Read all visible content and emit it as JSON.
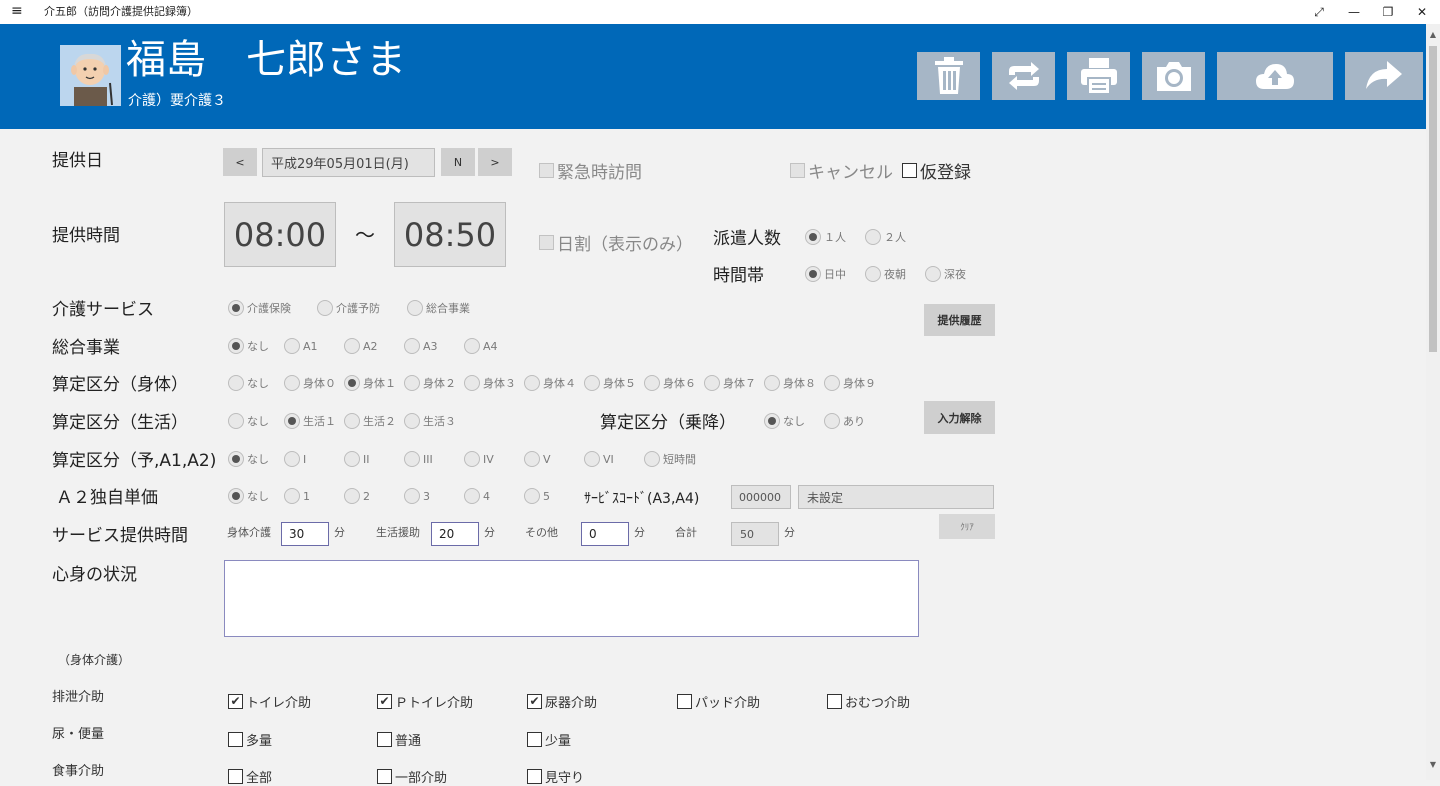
{
  "window": {
    "title": "介五郎（訪問介護提供記録簿）",
    "menu_icon": "hamburger-icon",
    "expand": "⤢",
    "minimize": "—",
    "restore": "❐",
    "close": "✕"
  },
  "header": {
    "name": "福島　七郎さま",
    "care_level": "介護）要介護３",
    "bg_color": "#0068b8"
  },
  "toolbar": {
    "delete": "trash-icon",
    "refresh": "refresh-icon",
    "print": "printer-icon",
    "camera": "camera-icon",
    "upload": "cloud-upload-icon",
    "forward": "share-arrow-icon"
  },
  "date": {
    "label": "提供日",
    "prev": "<",
    "value": "平成29年05月01日(月)",
    "now": "N",
    "next": ">"
  },
  "flags": {
    "emergency": "緊急時訪問",
    "cancel": "キャンセル",
    "provisional": "仮登録",
    "daily": "日割（表示のみ）"
  },
  "time": {
    "label": "提供時間",
    "start": "08:00",
    "sep": "～",
    "end": "08:50"
  },
  "dispatch": {
    "label": "派遣人数",
    "opts": [
      "１人",
      "２人"
    ]
  },
  "timezone": {
    "label": "時間帯",
    "opts": [
      "日中",
      "夜朝",
      "深夜"
    ]
  },
  "service": {
    "label": "介護サービス",
    "opts": [
      "介護保険",
      "介護予防",
      "総合事業"
    ],
    "history_button": "提供履歴"
  },
  "sogo": {
    "label": "総合事業",
    "opts": [
      "なし",
      "A1",
      "A2",
      "A3",
      "A4"
    ]
  },
  "shintai": {
    "label": "算定区分（身体）",
    "opts": [
      "なし",
      "身体０",
      "身体１",
      "身体２",
      "身体３",
      "身体４",
      "身体５",
      "身体６",
      "身体７",
      "身体８",
      "身体９"
    ]
  },
  "seikatsu": {
    "label": "算定区分（生活）",
    "opts": [
      "なし",
      "生活１",
      "生活２",
      "生活３"
    ],
    "clear_button": "入力解除"
  },
  "joukou": {
    "label": "算定区分（乗降）",
    "opts": [
      "なし",
      "あり"
    ]
  },
  "yobou": {
    "label": "算定区分（予,A1,A2)",
    "opts": [
      "なし",
      "I",
      "II",
      "III",
      "IV",
      "V",
      "VI",
      "短時間"
    ]
  },
  "a2": {
    "label": "Ａ２独自単価",
    "opts": [
      "なし",
      "1",
      "2",
      "3",
      "4",
      "5"
    ]
  },
  "service_code": {
    "label": "ｻｰﾋﾞｽｺｰﾄﾞ(A3,A4)",
    "code": "000000",
    "name": "未設定",
    "clear": "ｸﾘｱ"
  },
  "service_time": {
    "label": "サービス提供時間",
    "body_label": "身体介護",
    "body": "30",
    "life_label": "生活援助",
    "life": "20",
    "other_label": "その他",
    "other": "0",
    "total_label": "合計",
    "total": "50",
    "unit": "分"
  },
  "condition": {
    "label": "心身の状況",
    "value": ""
  },
  "body_section": "（身体介護）",
  "excretion": {
    "label": "排泄介助",
    "items": [
      {
        "text": "トイレ介助",
        "checked": true
      },
      {
        "text": "Ｐトイレ介助",
        "checked": true
      },
      {
        "text": "尿器介助",
        "checked": true
      },
      {
        "text": "パッド介助",
        "checked": false
      },
      {
        "text": "おむつ介助",
        "checked": false
      }
    ]
  },
  "urine": {
    "label": "尿・便量",
    "items": [
      {
        "text": "多量",
        "checked": false
      },
      {
        "text": "普通",
        "checked": false
      },
      {
        "text": "少量",
        "checked": false
      }
    ]
  },
  "meal": {
    "label": "食事介助",
    "items": [
      {
        "text": "全部",
        "checked": false
      },
      {
        "text": "一部介助",
        "checked": false
      },
      {
        "text": "見守り",
        "checked": false
      }
    ]
  }
}
